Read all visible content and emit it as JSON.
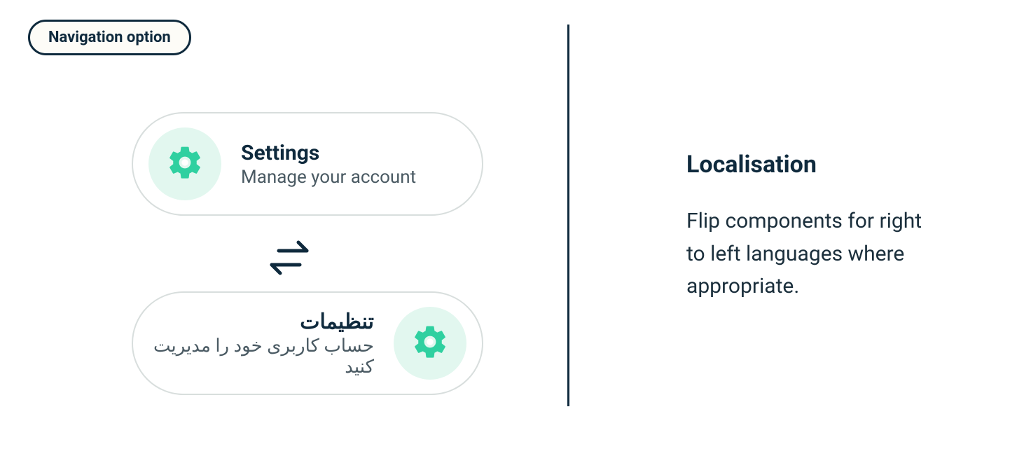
{
  "tag_label": "Navigation option",
  "ltr_card": {
    "title": "Settings",
    "subtitle": "Manage your account",
    "icon": "gear-icon"
  },
  "rtl_card": {
    "title": "تنظیمات",
    "subtitle": "حساب کاربری خود را مدیریت کنید",
    "icon": "gear-icon"
  },
  "swap_icon": "swap-horizontal-icon",
  "explanation": {
    "heading": "Localisation",
    "body": "Flip components for right to left languages where appropriate."
  },
  "colors": {
    "accent": "#2fd0a0",
    "accent_bg": "#e2f7ef",
    "text_primary": "#0f2a3d",
    "text_secondary": "#4a5a63",
    "border": "#d8dedd"
  }
}
